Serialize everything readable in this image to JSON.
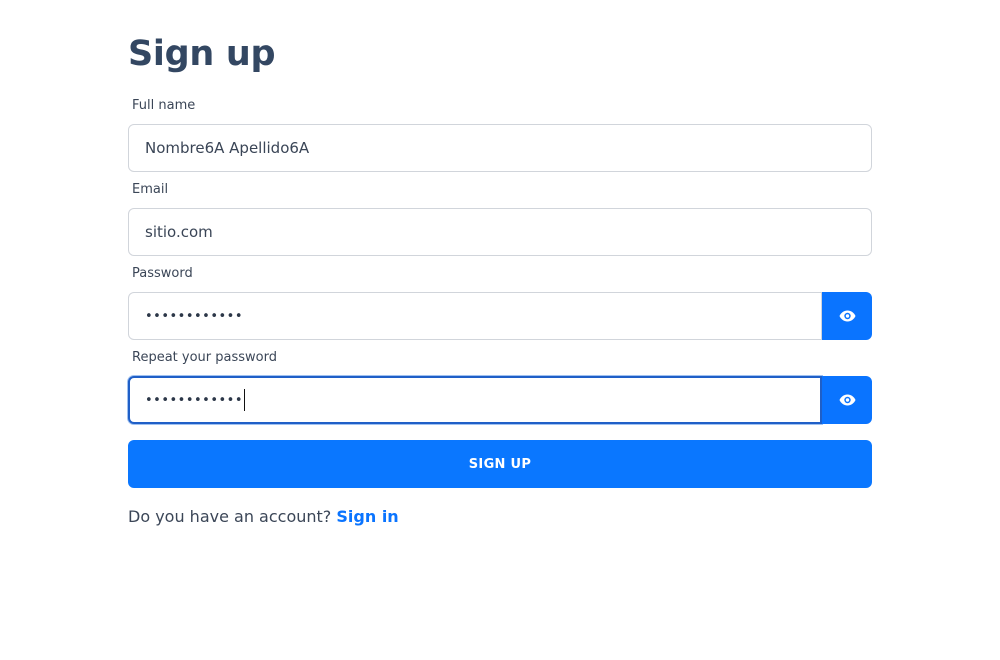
{
  "form": {
    "title": "Sign up",
    "fields": [
      {
        "label": "Full name",
        "value": "Nombre6A Apellido6A"
      },
      {
        "label": "Email",
        "value": "sitio.com"
      },
      {
        "label": "Password",
        "value": "••••••••••••"
      },
      {
        "label": "Repeat your password",
        "value": "••••••••••••"
      }
    ],
    "submit_label": "SIGN UP",
    "footer_text": "Do you have an account?",
    "footer_link": "Sign in"
  },
  "icons": {
    "password_toggle": "eye-icon",
    "repeat_password_toggle": "eye-icon"
  },
  "colors": {
    "primary": "#0a77ff",
    "title": "#334762",
    "focus_border": "#1f5fc7"
  }
}
